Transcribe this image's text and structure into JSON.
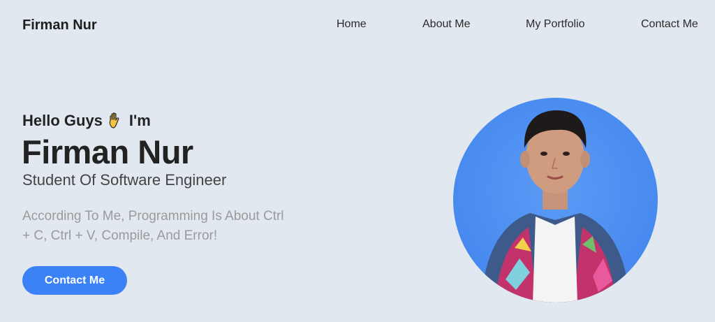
{
  "nav": {
    "brand": "Firman Nur",
    "links": [
      "Home",
      "About Me",
      "My Portfolio",
      "Contact Me"
    ]
  },
  "hero": {
    "greeting_prefix": "Hello Guys",
    "greeting_suffix": "I'm",
    "greeting_icon": "waving-hand-icon",
    "name": "Firman Nur",
    "role": "Student Of Software Engineer",
    "quote": "According To Me, Programming Is About Ctrl + C, Ctrl + V, Compile, And Error!",
    "cta_label": "Contact Me"
  },
  "colors": {
    "background": "#e2e8f0",
    "accent": "#3b82f6",
    "avatar_bg": "#4a8cf0",
    "muted_text": "#9a9a9a"
  },
  "avatar": {
    "icon": "profile-photo"
  }
}
